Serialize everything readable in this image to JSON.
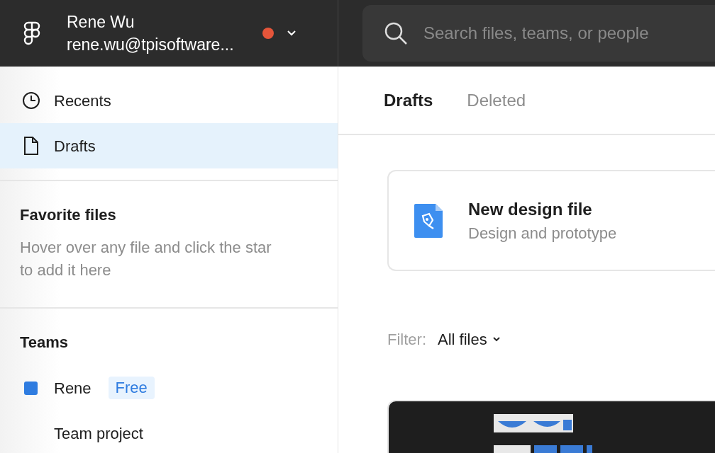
{
  "account": {
    "name": "Rene Wu",
    "email": "rene.wu@tpisoftware...",
    "has_notification": true
  },
  "search": {
    "placeholder": "Search files, teams, or people"
  },
  "sidebar": {
    "nav": [
      {
        "label": "Recents",
        "kind": "clock",
        "selected": false
      },
      {
        "label": "Drafts",
        "kind": "file",
        "selected": true
      }
    ],
    "favorites": {
      "title": "Favorite files",
      "hint": "Hover over any file and click the star to add it here"
    },
    "teams": {
      "title": "Teams",
      "items": [
        {
          "name": "Rene",
          "kind": "team",
          "color": "#2f7ce0",
          "badge": "Free"
        },
        {
          "name": "Team project",
          "kind": "project"
        }
      ]
    }
  },
  "tabs": [
    {
      "label": "Drafts",
      "selected": true
    },
    {
      "label": "Deleted",
      "selected": false
    }
  ],
  "new_file": {
    "title": "New design file",
    "subtitle": "Design and prototype"
  },
  "filter": {
    "label": "Filter:",
    "value": "All files"
  }
}
